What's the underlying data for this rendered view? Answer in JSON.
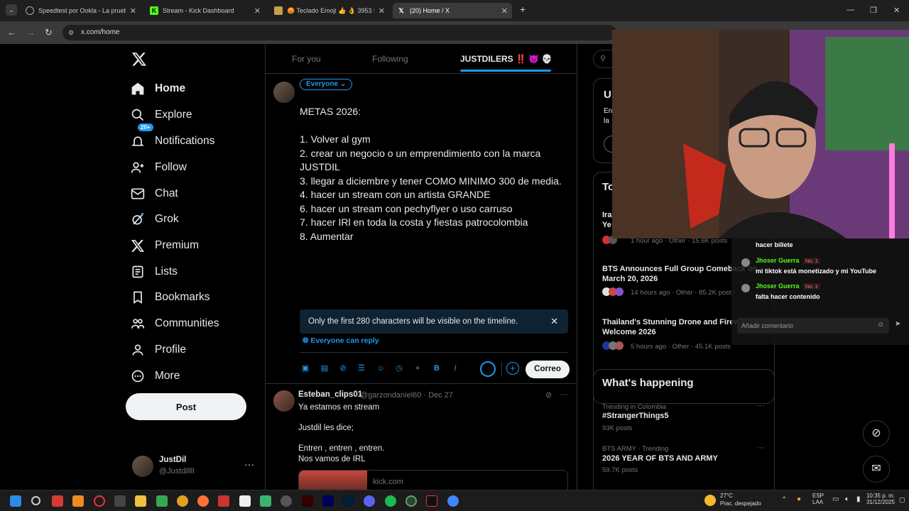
{
  "browser": {
    "tabs": [
      {
        "title": "Speedtest por Ookla - La prueba d",
        "active": false
      },
      {
        "title": "Stream - Kick Dashboard",
        "active": false
      },
      {
        "title": "😡 Teclado Emoji 👍 👌 3953 E",
        "active": false
      },
      {
        "title": "(20) Home / X",
        "active": true
      }
    ],
    "new_tab": "+",
    "url": "x.com/home"
  },
  "nav": {
    "notification_count": "20+",
    "items": [
      {
        "label": "Home",
        "icon": "home-icon"
      },
      {
        "label": "Explore",
        "icon": "search-icon"
      },
      {
        "label": "Notifications",
        "icon": "bell-icon"
      },
      {
        "label": "Follow",
        "icon": "person-add-icon"
      },
      {
        "label": "Chat",
        "icon": "mail-icon"
      },
      {
        "label": "Grok",
        "icon": "grok-icon"
      },
      {
        "label": "Premium",
        "icon": "x-logo-icon"
      },
      {
        "label": "Lists",
        "icon": "list-icon"
      },
      {
        "label": "Bookmarks",
        "icon": "bookmark-icon"
      },
      {
        "label": "Communities",
        "icon": "people-icon"
      },
      {
        "label": "Profile",
        "icon": "person-icon"
      },
      {
        "label": "More",
        "icon": "more-circle-icon"
      }
    ],
    "post_label": "Post",
    "profile": {
      "name": "JustDil",
      "handle": "@Justdillll"
    }
  },
  "feed_tabs": {
    "for_you": "For you",
    "following": "Following",
    "community": "JUSTDILERS ‼️ 😈 💀"
  },
  "compose": {
    "audience": "Everyone",
    "lines": [
      "METAS 2026:",
      "",
      "1. Volver al gym",
      "2. crear un negocio o un emprendimiento con la marca JUSTDIL",
      "3. llegar a diciembre y tener COMO MINIMO 300 de media.",
      "4. hacer un stream con un artista GRANDE",
      "6. hacer un stream con pechyflyer o uso carruso",
      "7. hacer IRl en toda la costa y fiestas patrocolombia",
      "8. Aumentar"
    ],
    "limit_notice": "Only the first 280 characters will be visible on the timeline.",
    "reply_setting": "Everyone can reply",
    "submit_label": "Correo"
  },
  "tweet": {
    "author": "Esteban_clips01",
    "meta": "@garzondaniel60 · Dec 27",
    "lines": [
      "Ya estamos en stream",
      "",
      "Justdil les dice;",
      "",
      "Entren , entren , entren.",
      "Nos vamos de IRL"
    ],
    "link_domain": "kick.com"
  },
  "right": {
    "premium_partial": {
      "title": "U",
      "line1": "En",
      "line2": "la"
    },
    "todays_news_partial": "To",
    "news": [
      {
        "title": "Ira",
        "title2": "Ye",
        "meta": "1 hour ago · Other · 15.6K posts"
      },
      {
        "title": "BTS Announces Full Group Comeback on March 20, 2026",
        "meta": "14 hours ago · Other · 85.2K posts"
      },
      {
        "title": "Thailand's Stunning Drone and Fireworks Welcome 2026",
        "meta": "5 hours ago · Other · 45.1K posts"
      }
    ],
    "whats_happening": "What's happening",
    "trends": [
      {
        "context": "Trending in Colombia",
        "title": "#StrangerThings5",
        "count": "93K posts"
      },
      {
        "context": "BTS ARMY · Trending",
        "title": "2026 YEAR OF BTS AND ARMY",
        "count": "59.7K posts"
      }
    ]
  },
  "chat": {
    "messages": [
      {
        "user": "",
        "text": "hacer billete"
      },
      {
        "user": "Jhoser Guerra",
        "badge": "No. 1",
        "text": "mi tiktok está monetizado y mi YouTube"
      },
      {
        "user": "Jhoser Guerra",
        "badge": "No. 1",
        "text": "falta hacer contenido"
      }
    ],
    "input_placeholder": "Añadir comentario"
  },
  "taskbar": {
    "weather_temp": "27°C",
    "weather_desc": "Prac. despejado",
    "lang1": "ESP",
    "lang2": "LAA",
    "time": "10:35 p. m.",
    "date": "31/12/2025"
  },
  "colors": {
    "accent": "#1d9bf0",
    "kick_green": "#53fc18",
    "bg": "#000000"
  }
}
